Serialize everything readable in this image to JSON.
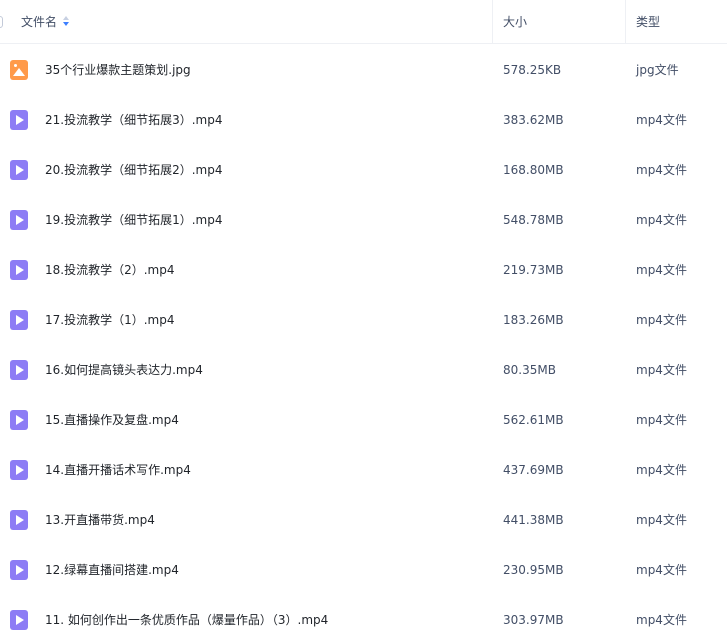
{
  "header": {
    "name_label": "文件名",
    "size_label": "大小",
    "type_label": "类型"
  },
  "files": [
    {
      "name": "35个行业爆款主题策划.jpg",
      "size": "578.25KB",
      "type": "jpg文件",
      "icon": "image-file-icon"
    },
    {
      "name": "21.投流教学（细节拓展3）.mp4",
      "size": "383.62MB",
      "type": "mp4文件",
      "icon": "video-file-icon"
    },
    {
      "name": "20.投流教学（细节拓展2）.mp4",
      "size": "168.80MB",
      "type": "mp4文件",
      "icon": "video-file-icon"
    },
    {
      "name": "19.投流教学（细节拓展1）.mp4",
      "size": "548.78MB",
      "type": "mp4文件",
      "icon": "video-file-icon"
    },
    {
      "name": "18.投流教学（2）.mp4",
      "size": "219.73MB",
      "type": "mp4文件",
      "icon": "video-file-icon"
    },
    {
      "name": "17.投流教学（1）.mp4",
      "size": "183.26MB",
      "type": "mp4文件",
      "icon": "video-file-icon"
    },
    {
      "name": "16.如何提高镜头表达力.mp4",
      "size": "80.35MB",
      "type": "mp4文件",
      "icon": "video-file-icon"
    },
    {
      "name": "15.直播操作及复盘.mp4",
      "size": "562.61MB",
      "type": "mp4文件",
      "icon": "video-file-icon"
    },
    {
      "name": "14.直播开播话术写作.mp4",
      "size": "437.69MB",
      "type": "mp4文件",
      "icon": "video-file-icon"
    },
    {
      "name": "13.开直播带货.mp4",
      "size": "441.38MB",
      "type": "mp4文件",
      "icon": "video-file-icon"
    },
    {
      "name": "12.绿幕直播间搭建.mp4",
      "size": "230.95MB",
      "type": "mp4文件",
      "icon": "video-file-icon"
    },
    {
      "name": "11. 如何创作出一条优质作品（爆量作品）（3）.mp4",
      "size": "303.97MB",
      "type": "mp4文件",
      "icon": "video-file-icon"
    }
  ],
  "colors": {
    "video_icon": "#8d7cf5",
    "image_icon": "#ff9a4a",
    "sort_active": "#3d7fff"
  }
}
